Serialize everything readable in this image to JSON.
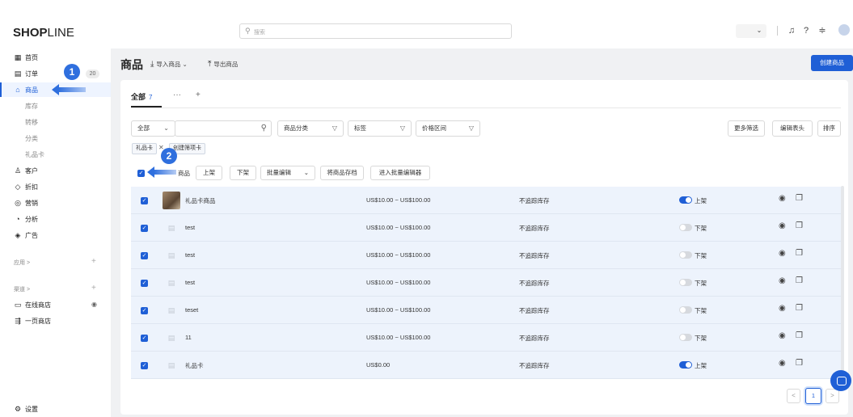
{
  "header": {
    "logo_bold": "SHOP",
    "logo_light": "LINE",
    "search_placeholder": "搜索"
  },
  "sidebar": {
    "items": [
      {
        "label": "首页",
        "icon": "dashboard-icon"
      },
      {
        "label": "订单",
        "icon": "order-icon",
        "badge": "20"
      },
      {
        "label": "商品",
        "icon": "product-icon",
        "active": true
      },
      {
        "label": "库存",
        "sub": true
      },
      {
        "label": "转移",
        "sub": true
      },
      {
        "label": "分类",
        "sub": true
      },
      {
        "label": "礼品卡",
        "sub": true
      },
      {
        "label": "客户",
        "icon": "customer-icon"
      },
      {
        "label": "折扣",
        "icon": "discount-icon"
      },
      {
        "label": "营销",
        "icon": "marketing-icon"
      },
      {
        "label": "分析",
        "icon": "analytics-icon"
      },
      {
        "label": "广告",
        "icon": "ads-icon"
      }
    ],
    "apps_label": "应用 >",
    "channels_label": "渠道 >",
    "channels": [
      {
        "label": "在线商店",
        "icon": "store-icon"
      },
      {
        "label": "一页商店",
        "icon": "one-page-store-icon"
      }
    ],
    "settings_label": "设置"
  },
  "page": {
    "title": "商品",
    "import_label": "导入商品 ⌄",
    "export_label": "导出商品",
    "create_label": "创建商品"
  },
  "tabs": {
    "all_label": "全部",
    "all_count": "7",
    "more": "···",
    "add": "+"
  },
  "filters": {
    "scope": "全部",
    "category": "商品分类",
    "tag": "标签",
    "price_range": "价格区间",
    "more_filters": "更多筛选",
    "edit_columns": "编辑表头",
    "sort": "排序"
  },
  "active_filter": {
    "chip": "礼品卡",
    "save_chip": "创建筛项卡"
  },
  "bulk": {
    "selected_text": "商品",
    "publish": "上架",
    "unpublish": "下架",
    "batch_edit": "批量编辑",
    "archive": "将商品存档",
    "bulk_editor": "进入批量编辑器"
  },
  "products": [
    {
      "name": "礼品卡商品",
      "price": "US$10.00 ~ US$100.00",
      "stock": "不追踪库存",
      "published": true,
      "status": "上架",
      "thumb": "image"
    },
    {
      "name": "test",
      "price": "US$10.00 ~ US$100.00",
      "stock": "不追踪库存",
      "published": false,
      "status": "下架",
      "thumb": "placeholder"
    },
    {
      "name": "test",
      "price": "US$10.00 ~ US$100.00",
      "stock": "不追踪库存",
      "published": false,
      "status": "下架",
      "thumb": "placeholder"
    },
    {
      "name": "test",
      "price": "US$10.00 ~ US$100.00",
      "stock": "不追踪库存",
      "published": false,
      "status": "下架",
      "thumb": "placeholder"
    },
    {
      "name": "teset",
      "price": "US$10.00 ~ US$100.00",
      "stock": "不追踪库存",
      "published": false,
      "status": "下架",
      "thumb": "placeholder"
    },
    {
      "name": "11",
      "price": "US$10.00 ~ US$100.00",
      "stock": "不追踪库存",
      "published": false,
      "status": "下架",
      "thumb": "placeholder"
    },
    {
      "name": "礼品卡",
      "price": "US$0.00",
      "stock": "不追踪库存",
      "published": true,
      "status": "上架",
      "thumb": "placeholder"
    }
  ],
  "pagination": {
    "current": "1",
    "prev": "<",
    "next": ">"
  },
  "annotations": {
    "step1": "1",
    "step2": "2"
  },
  "colors": {
    "accent": "#1f5fd6",
    "annotation": "#2f6fde"
  }
}
